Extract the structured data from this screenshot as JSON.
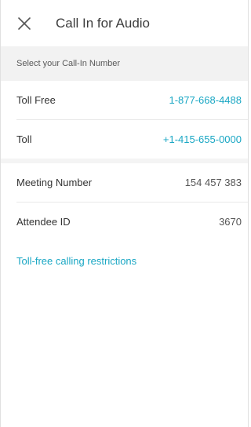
{
  "header": {
    "close_icon": "close-icon",
    "title": "Call In for Audio"
  },
  "section": {
    "title": "Select your Call-In Number"
  },
  "numbers": [
    {
      "label": "Toll Free",
      "value": "1-877-668-4488"
    },
    {
      "label": "Toll",
      "value": "+1-415-655-0000"
    }
  ],
  "info": [
    {
      "label": "Meeting Number",
      "value": "154 457 383"
    },
    {
      "label": "Attendee ID",
      "value": "3670"
    }
  ],
  "restrictions_link": "Toll-free calling restrictions",
  "colors": {
    "accent": "#1aa7c4",
    "section_bg": "#f2f2f2"
  }
}
